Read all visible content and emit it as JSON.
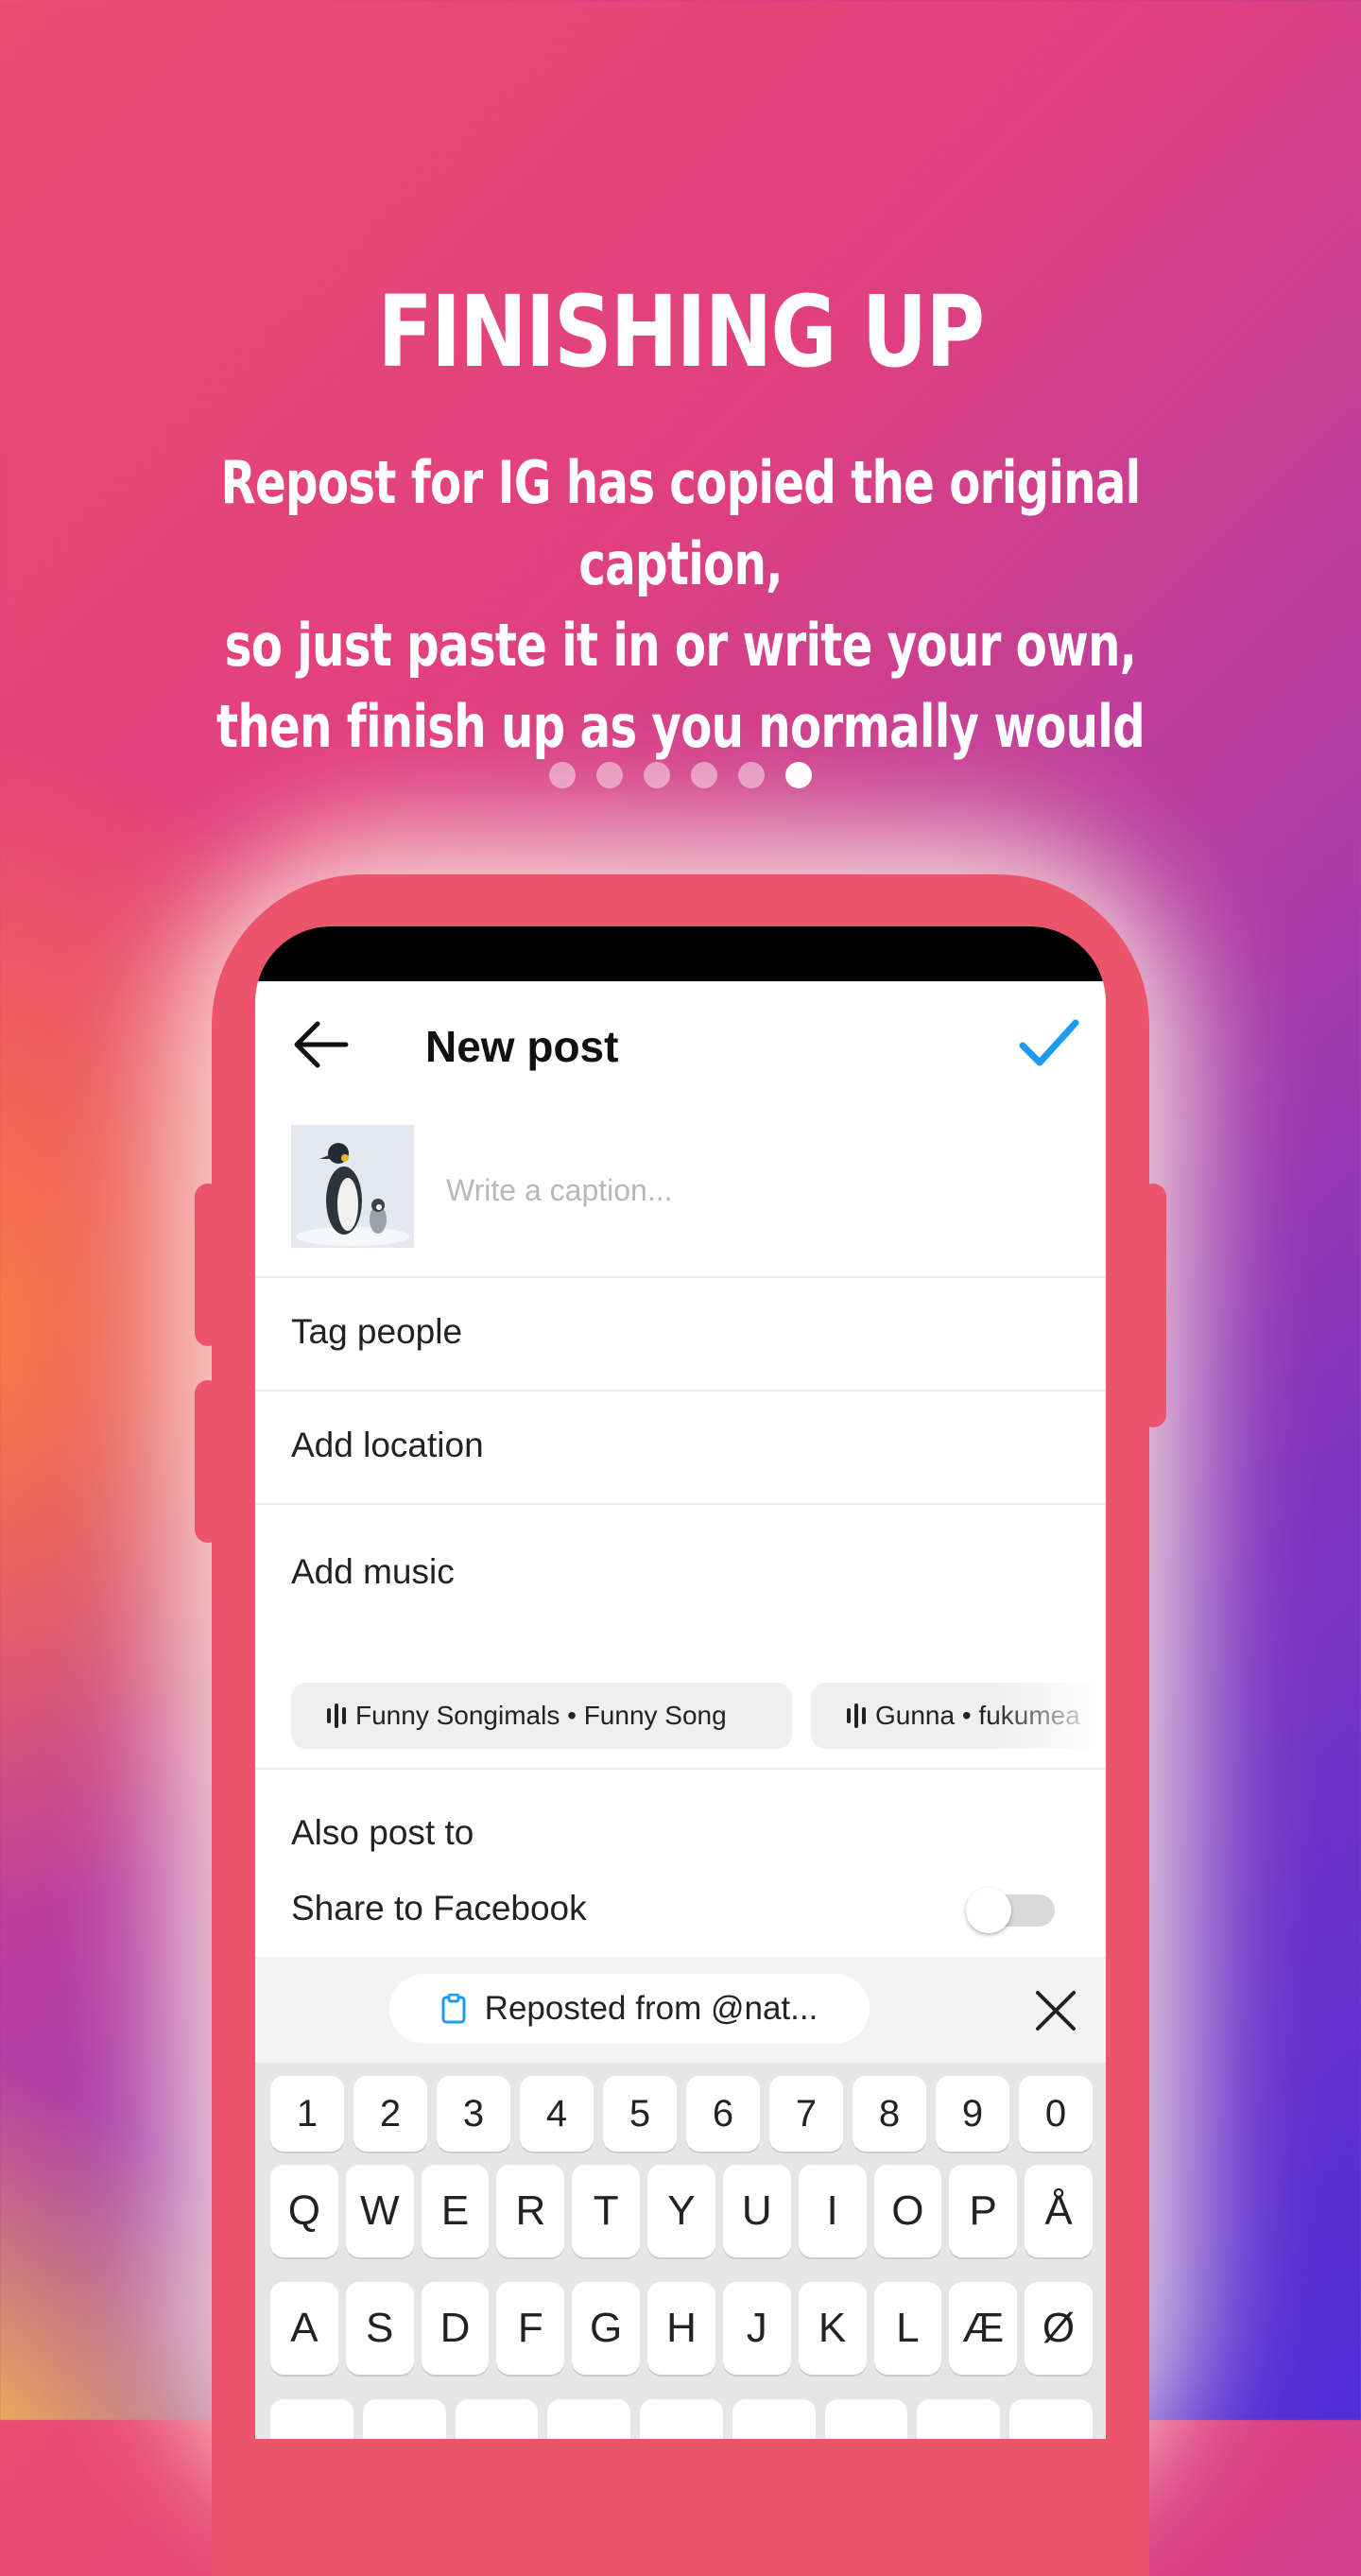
{
  "hero": {
    "title": "FINISHING UP",
    "subtitle_lines": [
      "Repost for IG has copied the original caption,",
      "so just paste it in or write your own,",
      "then finish up as you normally would"
    ],
    "pager": {
      "total": 6,
      "active_index": 6
    }
  },
  "app": {
    "header": {
      "title": "New post",
      "back_icon": "arrow-left-icon",
      "confirm_icon": "checkmark-icon",
      "accent": "#1d9bf0"
    },
    "caption": {
      "placeholder": "Write a caption...",
      "thumbnail": "penguin-photo"
    },
    "menu": {
      "tag_people": "Tag people",
      "add_location": "Add location",
      "add_music": "Add music"
    },
    "music_suggestions": [
      "Funny Songimals • Funny Song",
      "Gunna • fukumea"
    ],
    "also_post_to": "Also post to",
    "share_facebook": {
      "label": "Share to Facebook",
      "enabled": false
    },
    "clipboard": {
      "text": "Reposted from @nat...",
      "icon": "clipboard-icon"
    },
    "keyboard": {
      "row_numbers": [
        "1",
        "2",
        "3",
        "4",
        "5",
        "6",
        "7",
        "8",
        "9",
        "0"
      ],
      "row_1": [
        "Q",
        "W",
        "E",
        "R",
        "T",
        "Y",
        "U",
        "I",
        "O",
        "P",
        "Å"
      ],
      "row_2": [
        "A",
        "S",
        "D",
        "F",
        "G",
        "H",
        "J",
        "K",
        "L",
        "Æ",
        "Ø"
      ]
    }
  },
  "colors": {
    "phone_frame": "#ec546c",
    "background_start": "#ea4c74",
    "background_end": "#4f2fd9"
  }
}
